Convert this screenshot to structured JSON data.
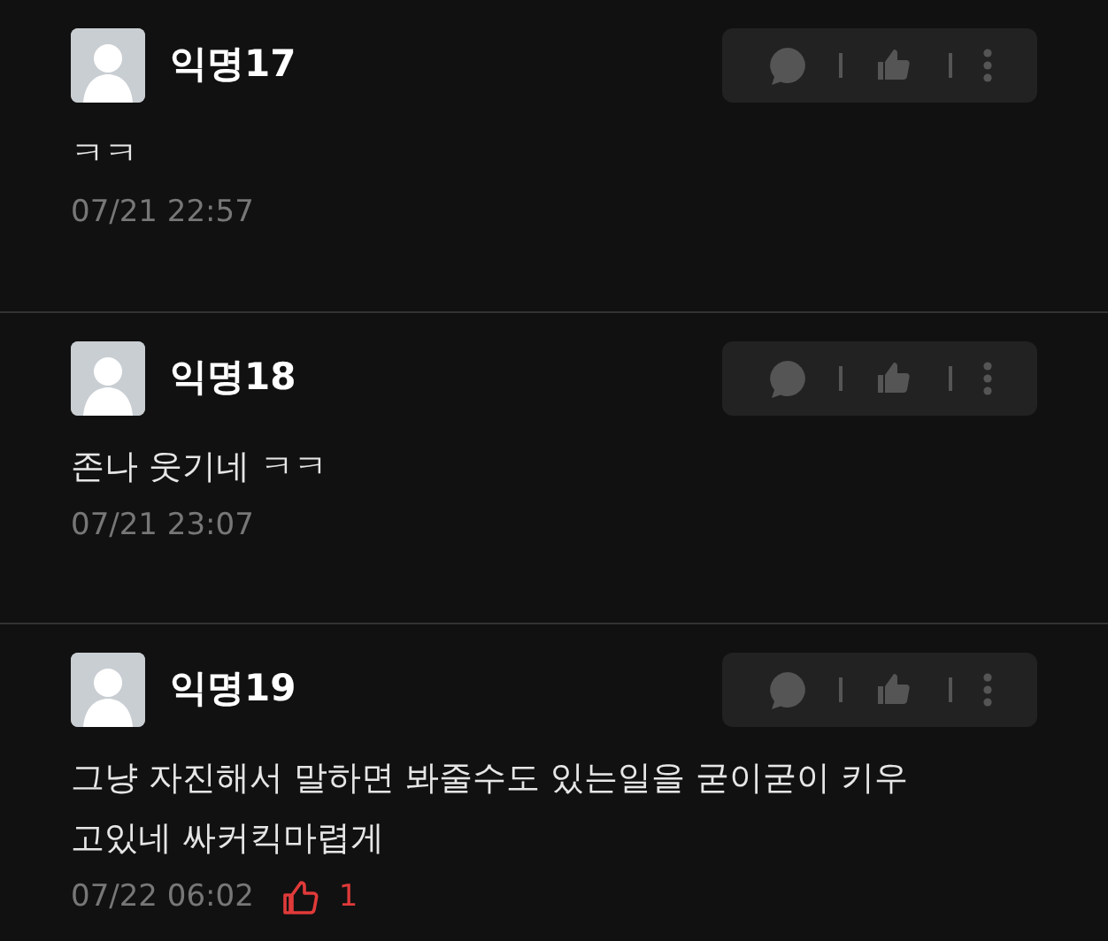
{
  "comments": [
    {
      "author": "익명17",
      "text": "ㅋㅋ",
      "time": "07/21 22:57"
    },
    {
      "author": "익명18",
      "text": "존나 웃기네 ㅋㅋ",
      "time": "07/21 23:07"
    },
    {
      "author": "익명19",
      "text": "그냥 자진해서 말하면 봐줄수도 있는일을 굳이굳이 키우고있네 싸커킥마렵게",
      "time": "07/22 06:02",
      "likes": "1"
    }
  ]
}
